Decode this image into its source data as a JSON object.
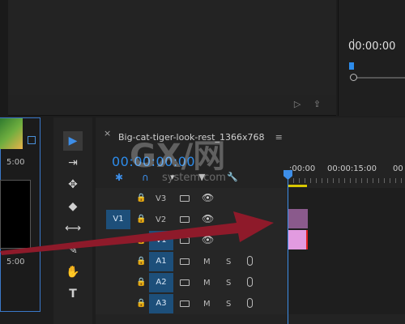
{
  "source_monitor": {
    "timecode": "00:00:00"
  },
  "project": {
    "durations": [
      "5:00",
      "5:00"
    ]
  },
  "timeline": {
    "tab_title": "Big-cat-tiger-look-rest_1366x768",
    "menu_glyph": "≡",
    "close_glyph": "×",
    "timecode": "00:00:00:00",
    "ruler": [
      ":00:00",
      "00:00:15:00",
      "00"
    ],
    "tracks": [
      {
        "name": "V3",
        "type": "video"
      },
      {
        "name": "V2",
        "type": "video",
        "source_patch": "V1"
      },
      {
        "name": "V1",
        "type": "video",
        "target": "V1"
      },
      {
        "name": "A1",
        "type": "audio",
        "target": "A1"
      },
      {
        "name": "A2",
        "type": "audio",
        "target": "A2"
      },
      {
        "name": "A3",
        "type": "audio",
        "target": "A3"
      }
    ],
    "audio_buttons": {
      "mute": "M",
      "solo": "S"
    }
  },
  "watermark": {
    "text": "GX/网",
    "sub": "system.com"
  },
  "colors": {
    "accent": "#2d8ceb",
    "clip_v1": "#e29be0",
    "clip_v2": "#8a5a8c",
    "arrow": "#8e1a2a"
  },
  "icons": [
    "selection-tool-icon",
    "track-select-icon",
    "ripple-edit-icon",
    "razor-icon",
    "slip-icon",
    "pen-icon",
    "hand-icon",
    "type-icon",
    "lock-icon",
    "camera-icon",
    "eye-icon",
    "mic-icon"
  ]
}
